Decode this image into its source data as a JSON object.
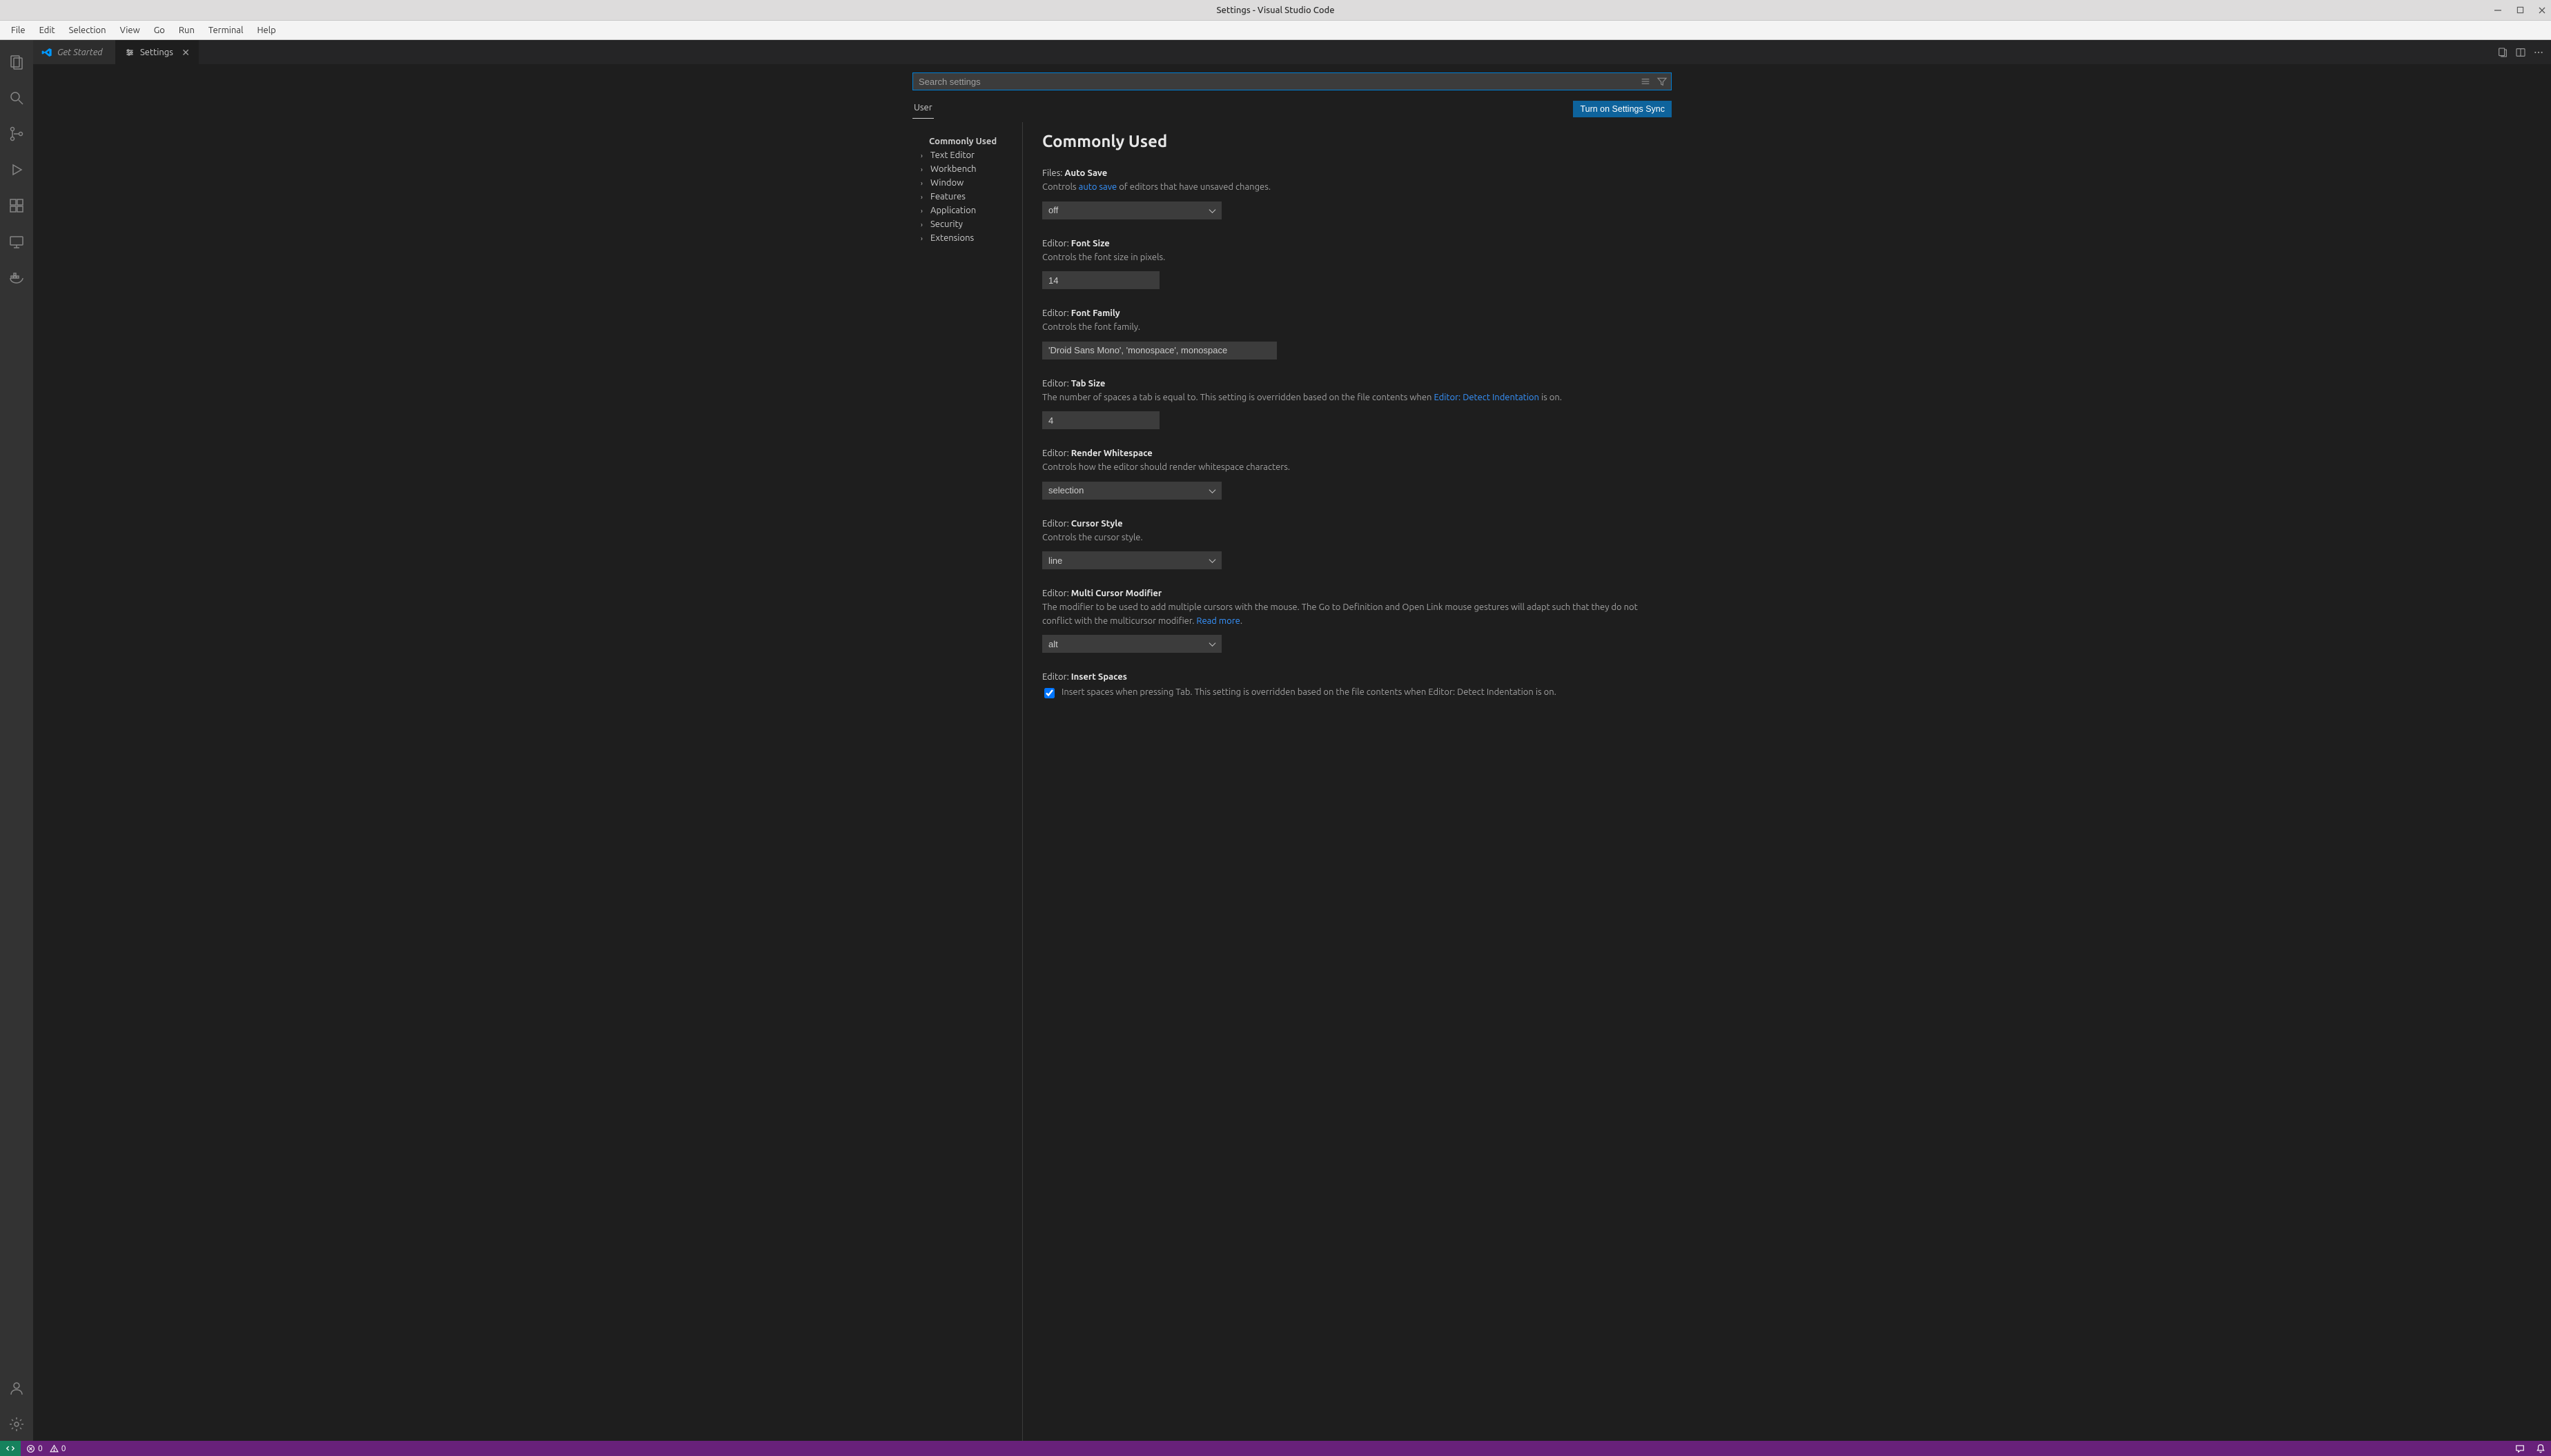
{
  "window": {
    "title": "Settings - Visual Studio Code"
  },
  "menu": [
    "File",
    "Edit",
    "Selection",
    "View",
    "Go",
    "Run",
    "Terminal",
    "Help"
  ],
  "tabs": {
    "t0": {
      "label": "Get Started"
    },
    "t1": {
      "label": "Settings"
    }
  },
  "search": {
    "placeholder": "Search settings"
  },
  "scope": {
    "user": "User",
    "sync": "Turn on Settings Sync"
  },
  "toc": {
    "commonly": "Commonly Used",
    "items": [
      "Text Editor",
      "Workbench",
      "Window",
      "Features",
      "Application",
      "Security",
      "Extensions"
    ]
  },
  "heading": "Commonly Used",
  "s0": {
    "scope": "Files: ",
    "name": "Auto Save",
    "desc_a": "Controls ",
    "link": "auto save",
    "desc_b": " of editors that have unsaved changes.",
    "value": "off"
  },
  "s1": {
    "scope": "Editor: ",
    "name": "Font Size",
    "desc": "Controls the font size in pixels.",
    "value": "14"
  },
  "s2": {
    "scope": "Editor: ",
    "name": "Font Family",
    "desc": "Controls the font family.",
    "value": "'Droid Sans Mono', 'monospace', monospace"
  },
  "s3": {
    "scope": "Editor: ",
    "name": "Tab Size",
    "desc_a": "The number of spaces a tab is equal to. This setting is overridden based on the file contents when ",
    "link": "Editor: Detect Indentation",
    "desc_b": " is on.",
    "value": "4"
  },
  "s4": {
    "scope": "Editor: ",
    "name": "Render Whitespace",
    "desc": "Controls how the editor should render whitespace characters.",
    "value": "selection"
  },
  "s5": {
    "scope": "Editor: ",
    "name": "Cursor Style",
    "desc": "Controls the cursor style.",
    "value": "line"
  },
  "s6": {
    "scope": "Editor: ",
    "name": "Multi Cursor Modifier",
    "desc_a": "The modifier to be used to add multiple cursors with the mouse. The Go to Definition and Open Link mouse gestures will adapt such that they do not conflict with the multicursor modifier. ",
    "link": "Read more",
    "desc_b": ".",
    "value": "alt"
  },
  "s7": {
    "scope": "Editor: ",
    "name": "Insert Spaces",
    "desc_a": "Insert spaces when pressing ",
    "key": "Tab",
    "desc_b": ". This setting is overridden based on the file contents when ",
    "link": "Editor: Detect Indentation",
    "desc_c": " is on."
  },
  "status": {
    "errors": "0",
    "warnings": "0"
  }
}
